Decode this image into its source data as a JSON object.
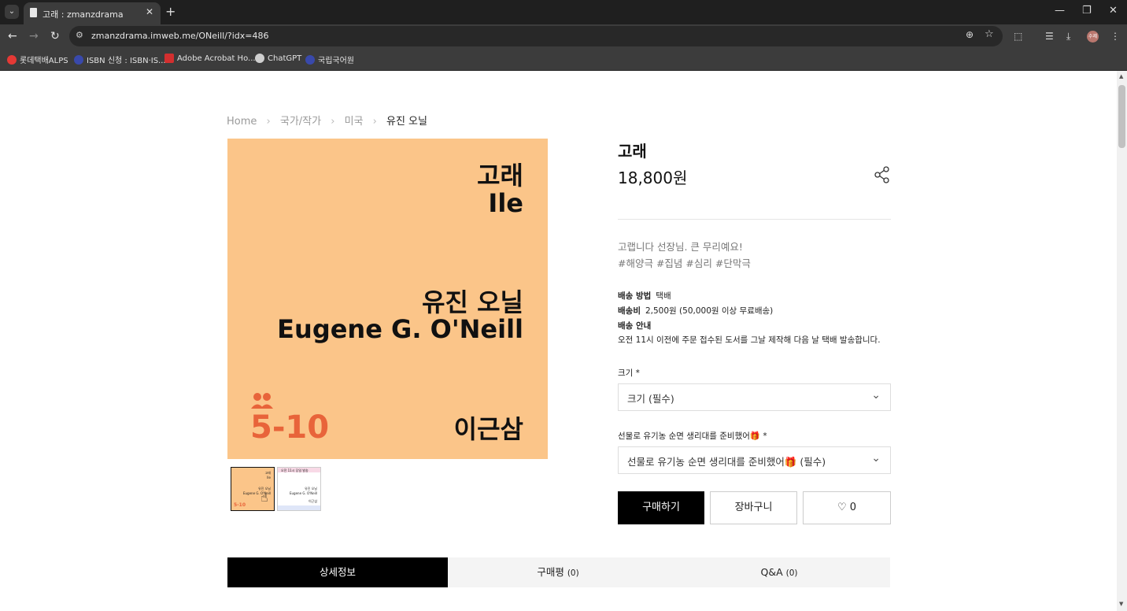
{
  "browser": {
    "tab_title": "고래 : zmanzdrama",
    "url": "zmanzdrama.imweb.me/ONeill/?idx=486",
    "profile_initials": "수제",
    "bookmarks": [
      {
        "label": "롯데택배ALPS",
        "color": "#e53935"
      },
      {
        "label": "ISBN 신청 : ISBN·IS...",
        "color": "#3949ab"
      },
      {
        "label": "Adobe Acrobat Ho...",
        "color": "#d32f2f"
      },
      {
        "label": "ChatGPT",
        "color": "#cfcfcf"
      },
      {
        "label": "국립국어원",
        "color": "#3949ab"
      }
    ]
  },
  "breadcrumb": {
    "home": "Home",
    "level1": "국가/작가",
    "level2": "미국",
    "current": "유진 오닐"
  },
  "cover": {
    "title_ko": "고래",
    "title_en": "Ile",
    "author_ko": "유진 오닐",
    "author_en": "Eugene G. O'Neill",
    "translator": "이근삼",
    "cast": "5-10",
    "bg_color": "#fbc589",
    "accent_color": "#e8643a"
  },
  "thumbnails": {
    "t1": {
      "title": "고래",
      "en": "Ile",
      "author": "유진 오닐",
      "author_en": "Eugene G. O'Neill",
      "cast": "5-10"
    },
    "t2": {
      "top": "오전 11시 당일 발송",
      "author": "유진 오닐",
      "author_en": "Eugene G. O'Neill",
      "translator": "이근삼"
    }
  },
  "product": {
    "title": "고래",
    "price": "18,800원",
    "description": "고랩니다 선장님. 큰 무리예요!",
    "tags": "#해양극 #집념 #심리 #단막극",
    "shipping": {
      "method_label": "배송 방법",
      "method_value": "택배",
      "fee_label": "배송비",
      "fee_value": "2,500원 (50,000원 이상 무료배송)",
      "guide_label": "배송 안내",
      "guide_value": "오전 11시 이전에 주문 접수된 도서를 그날 제작해 다음 날 택배 발송합니다."
    },
    "option1": {
      "label": "크기 *",
      "placeholder": "크기 (필수)"
    },
    "option2": {
      "label": "선물로 유기농 순면 생리대를 준비했어🎁 *",
      "placeholder": "선물로 유기농 순면 생리대를 준비했어🎁 (필수)"
    },
    "buy_label": "구매하기",
    "cart_label": "장바구니",
    "like_count": "0"
  },
  "tabs": [
    {
      "label": "상세정보",
      "count": ""
    },
    {
      "label": "구매평",
      "count": "(0)"
    },
    {
      "label": "Q&A",
      "count": "(0)"
    }
  ]
}
